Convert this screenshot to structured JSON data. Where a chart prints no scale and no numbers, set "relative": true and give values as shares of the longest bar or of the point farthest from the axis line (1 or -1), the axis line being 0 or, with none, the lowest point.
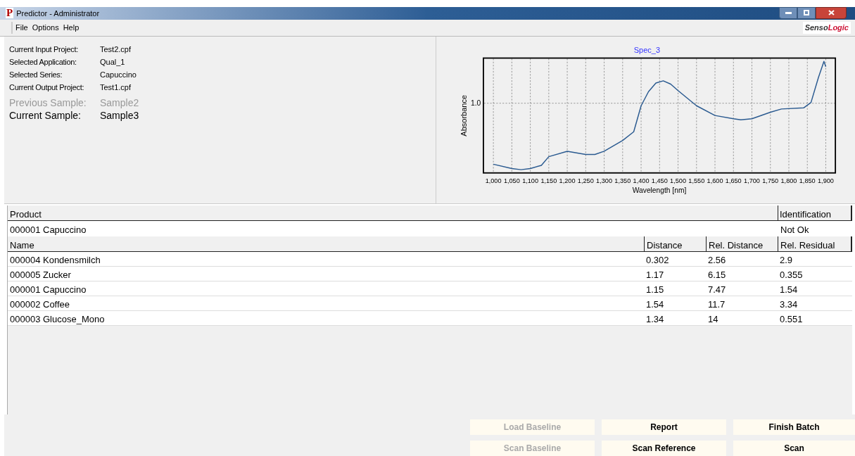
{
  "window": {
    "icon_letter": "P",
    "title": "Predictor - Administrator"
  },
  "menu": [
    {
      "label": "File"
    },
    {
      "label": "Options"
    },
    {
      "label": "Help"
    }
  ],
  "brand": {
    "part_1": "Senso",
    "part_2": "Logic"
  },
  "info": [
    {
      "label": "Current Input Project:",
      "value": "Test2.cpf"
    },
    {
      "label": "Selected Application:",
      "value": "Qual_1"
    },
    {
      "label": "Selected Series:",
      "value": "Capuccino"
    },
    {
      "label": "Current Output Project:",
      "value": "Test1.cpf"
    }
  ],
  "samples": [
    {
      "label": "Previous Sample:",
      "value": "Sample2",
      "kind": "previous"
    },
    {
      "label": "Current Sample:",
      "value": "Sample3",
      "kind": "current"
    }
  ],
  "spectrum": {
    "chart_data": {
      "type": "line",
      "title": "Spec_3",
      "xlabel": "Wavelength [nm]",
      "ylabel": "Absorbance",
      "x": [
        1000,
        1050,
        1075,
        1100,
        1130,
        1150,
        1200,
        1250,
        1275,
        1300,
        1350,
        1380,
        1400,
        1420,
        1440,
        1460,
        1480,
        1500,
        1550,
        1600,
        1650,
        1670,
        1700,
        1750,
        1780,
        1840,
        1860,
        1880,
        1895,
        1900
      ],
      "series": [
        {
          "color": "#2a5a90",
          "values": [
            0.05,
            0.01,
            0,
            0.01,
            0.04,
            0.12,
            0.17,
            0.14,
            0.14,
            0.17,
            0.27,
            0.35,
            0.59,
            0.72,
            0.8,
            0.82,
            0.79,
            0.73,
            0.59,
            0.5,
            0.47,
            0.46,
            0.47,
            0.53,
            0.56,
            0.57,
            0.62,
            0.85,
            1,
            0.95
          ]
        }
      ],
      "xlim": [
        973,
        1926
      ],
      "relative": true,
      "grid": true,
      "xticks": [
        {
          "value": 1000,
          "label": "1,000"
        },
        {
          "value": 1050,
          "label": "1,050"
        },
        {
          "value": 1100,
          "label": "1,100"
        },
        {
          "value": 1150,
          "label": "1,150"
        },
        {
          "value": 1200,
          "label": "1,200"
        },
        {
          "value": 1250,
          "label": "1,250"
        },
        {
          "value": 1300,
          "label": "1,300"
        },
        {
          "value": 1350,
          "label": "1,350"
        },
        {
          "value": 1400,
          "label": "1,400"
        },
        {
          "value": 1450,
          "label": "1,450"
        },
        {
          "value": 1500,
          "label": "1,500"
        },
        {
          "value": 1550,
          "label": "1,550"
        },
        {
          "value": 1600,
          "label": "1,600"
        },
        {
          "value": 1650,
          "label": "1,650"
        },
        {
          "value": 1700,
          "label": "1,700"
        },
        {
          "value": 1750,
          "label": "1,750"
        },
        {
          "value": 1800,
          "label": "1,800"
        },
        {
          "value": 1850,
          "label": "1,850"
        },
        {
          "value": 1900,
          "label": "1,900"
        }
      ],
      "annotations": [
        {
          "text": "1.0"
        }
      ]
    }
  },
  "product_table": {
    "columns": [
      "Product",
      "Identification"
    ],
    "rows": [
      [
        "000001 Capuccino",
        "Not Ok"
      ]
    ]
  },
  "results_table": {
    "columns": [
      "Name",
      "Distance",
      "Rel. Distance",
      "Rel. Residual"
    ],
    "rows": [
      [
        "000004 Kondensmilch",
        "0.302",
        "2.56",
        "2.9"
      ],
      [
        "000005 Zucker",
        "1.17",
        "6.15",
        "0.355"
      ],
      [
        "000001 Capuccino",
        "1.15",
        "7.47",
        "1.54"
      ],
      [
        "000002 Coffee",
        "1.54",
        "11.7",
        "3.34"
      ],
      [
        "000003 Glucose_Mono",
        "1.34",
        "14",
        "0.551"
      ]
    ]
  },
  "buttons": [
    {
      "label": "Load Baseline",
      "disabled": true
    },
    {
      "label": "Report",
      "disabled": false
    },
    {
      "label": "Finish Batch",
      "disabled": false
    },
    {
      "label": "Scan Baseline",
      "disabled": true
    },
    {
      "label": "Scan Reference",
      "disabled": false
    },
    {
      "label": "Scan",
      "disabled": false
    }
  ]
}
